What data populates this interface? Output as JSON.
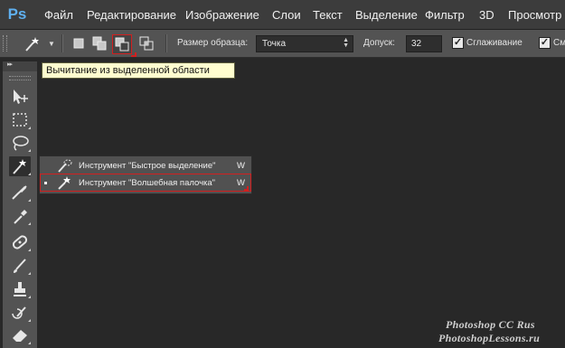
{
  "app": {
    "logo": "Ps"
  },
  "menu": [
    "Файл",
    "Редактирование",
    "Изображение",
    "Слои",
    "Текст",
    "Выделение",
    "Фильтр",
    "3D",
    "Просмотр"
  ],
  "options": {
    "sample_size_label": "Размер образца:",
    "sample_size_value": "Точка",
    "tolerance_label": "Допуск:",
    "tolerance_value": "32",
    "antialias_label": "Сглаживание",
    "contiguous_label_partial": "Сме"
  },
  "tooltip": "Вычитание из выделенной области",
  "flyout": [
    {
      "label": "Инструмент \"Быстрое выделение\"",
      "shortcut": "W",
      "icon": "quick-selection-icon",
      "active": false
    },
    {
      "label": "Инструмент \"Волшебная палочка\"",
      "shortcut": "W",
      "icon": "magic-wand-icon",
      "active": true
    }
  ],
  "watermark": {
    "line1": "Photoshop  CC  Rus",
    "line2": "PhotoshopLessons.ru"
  },
  "colors": {
    "highlight": "#d21f1f",
    "ps_blue": "#5fb0f0",
    "tooltip_bg": "#fffdcf"
  }
}
